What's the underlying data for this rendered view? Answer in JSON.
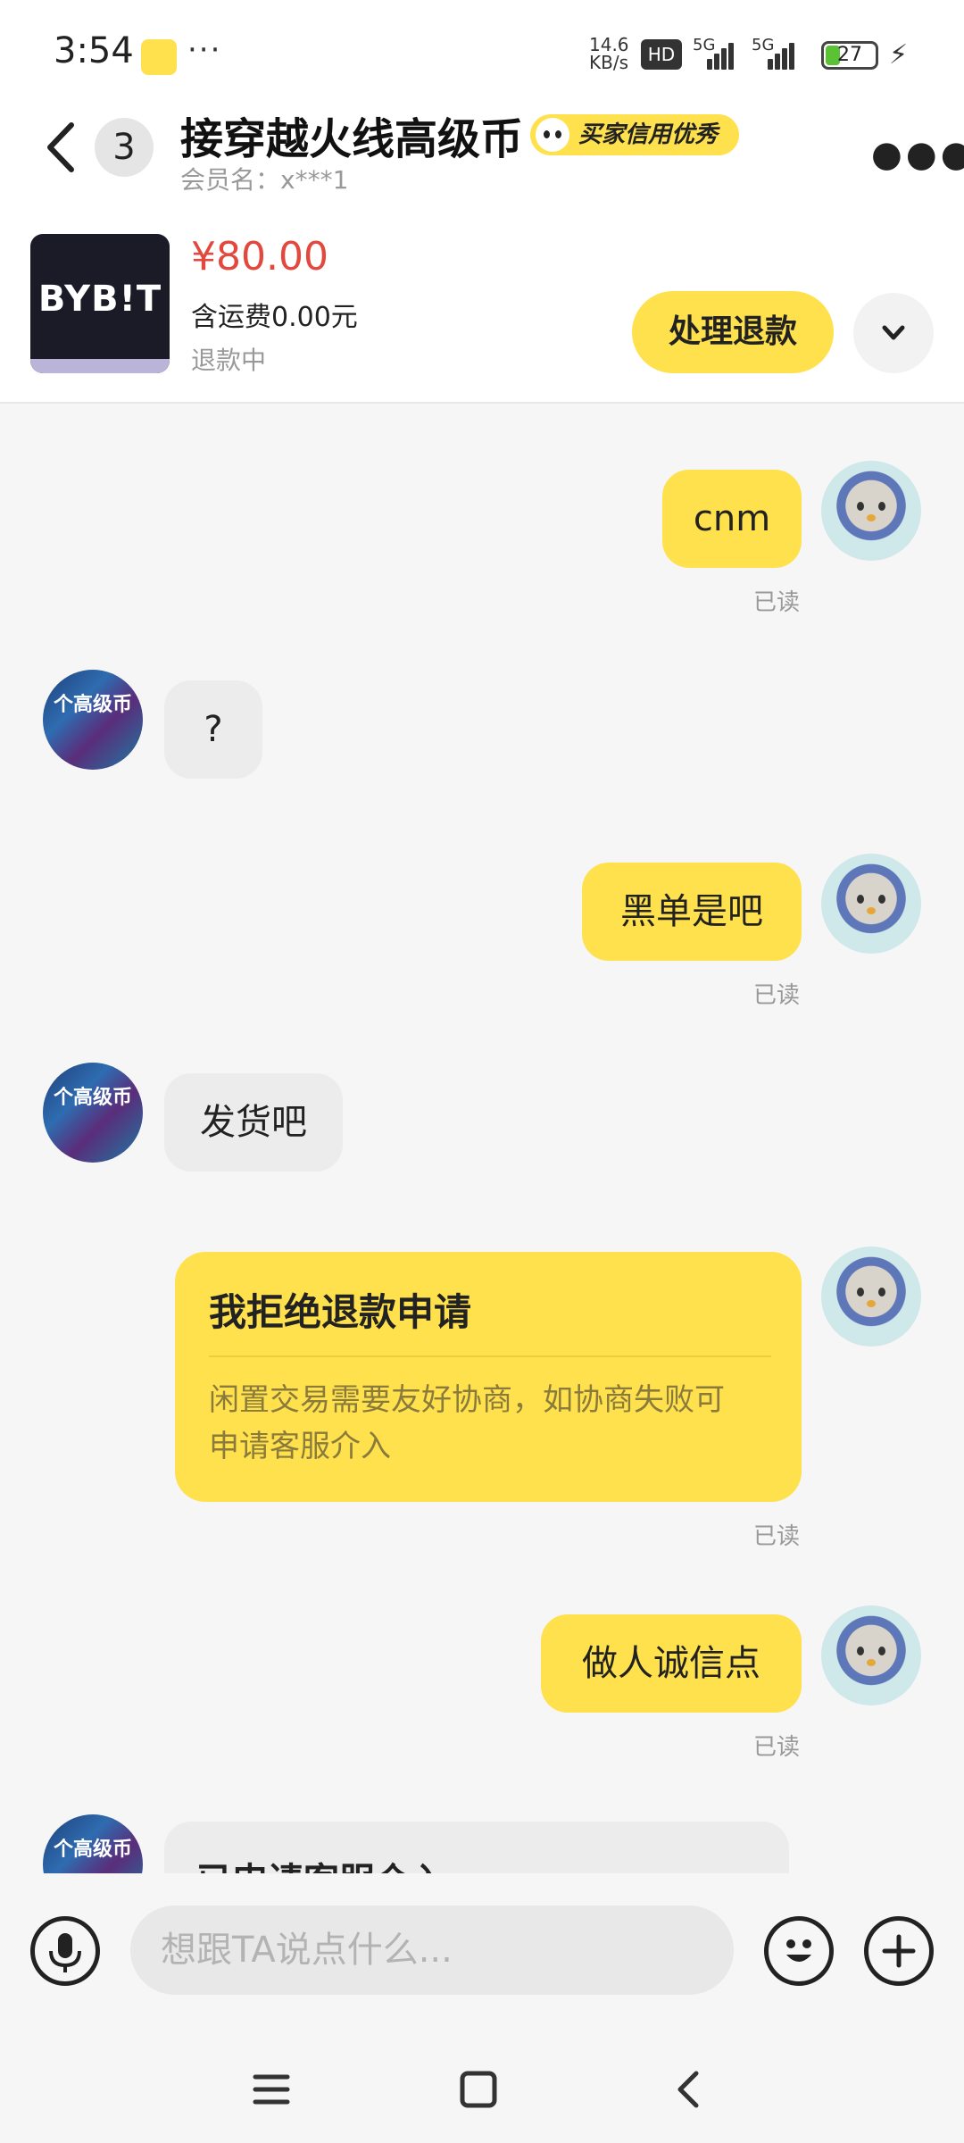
{
  "status_bar": {
    "time": "3:54",
    "dots": "···",
    "net_speed_value": "14.6",
    "net_speed_unit": "KB/s",
    "hd": "HD",
    "signal_1": "5G",
    "signal_2": "5G",
    "battery": "27",
    "icons": [
      "app-notification-icon",
      "hd-icon",
      "signal-icon",
      "battery-icon",
      "charging-icon"
    ]
  },
  "header": {
    "unread_count": "3",
    "title": "接穿越火线高级币",
    "badge": "买家信用优秀",
    "member": "会员名：x***1"
  },
  "product": {
    "image_logo": "BYB!T",
    "price": "¥80.00",
    "shipping": "含运费0.00元",
    "status": "退款中",
    "action": "处理退款"
  },
  "messages": [
    {
      "from": "me",
      "text": "cnm",
      "status": "已读"
    },
    {
      "from": "them",
      "text": "?"
    },
    {
      "from": "me",
      "text": "黑单是吧",
      "status": "已读"
    },
    {
      "from": "them",
      "text": "发货吧"
    },
    {
      "from": "me",
      "card_title": "我拒绝退款申请",
      "card_body": "闲置交易需要友好协商，如协商失败可申请客服介入",
      "status": "已读"
    },
    {
      "from": "me",
      "text": "做人诚信点",
      "status": "已读"
    },
    {
      "from": "them",
      "text": "已申请客服介入"
    }
  ],
  "avatar_text": "个高级币",
  "input": {
    "placeholder": "想跟TA说点什么..."
  },
  "colors": {
    "accent": "#ffe14d",
    "price": "#e2483d",
    "bubble_them": "#ececec",
    "read": "#999999"
  }
}
